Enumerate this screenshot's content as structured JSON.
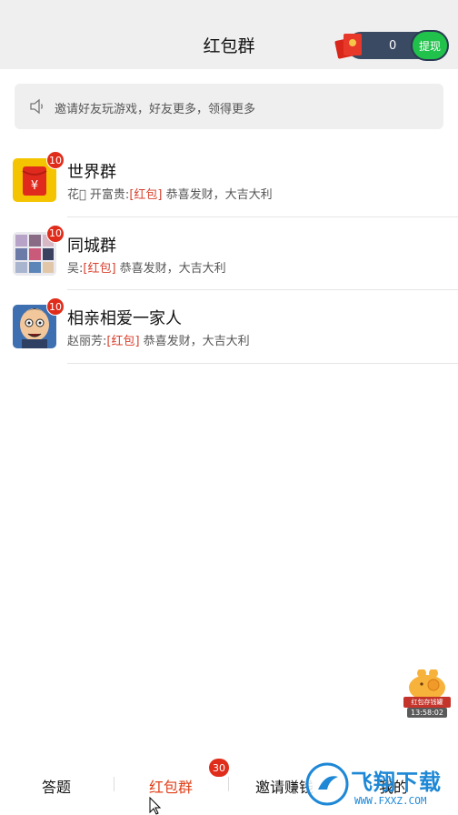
{
  "header": {
    "title": "红包群",
    "wallet_amount": "0",
    "withdraw_label": "提现"
  },
  "notice": {
    "text": "邀请好友玩游戏，好友更多，领得更多"
  },
  "groups": [
    {
      "name": "世界群",
      "badge": "10",
      "sender": "花\u0000 开富贵:",
      "tag": "[红包]",
      "message": " 恭喜发财，大吉大利"
    },
    {
      "name": "同城群",
      "badge": "10",
      "sender": "吴:",
      "tag": "[红包]",
      "message": " 恭喜发财，大吉大利"
    },
    {
      "name": "相亲相爱一家人",
      "badge": "10",
      "sender": "赵丽芳:",
      "tag": "[红包]",
      "message": " 恭喜发财，大吉大利"
    }
  ],
  "float_widget": {
    "label": "红包存钱罐",
    "time": "13:58:02"
  },
  "bottom_nav": {
    "items": [
      "答题",
      "红包群",
      "邀请赚钱",
      "我的"
    ],
    "badge": "30"
  },
  "watermark": {
    "text": "飞翔下载",
    "url": "WWW.FXXZ.COM"
  },
  "colors": {
    "accent": "#e0401a",
    "badge": "#e02d1b",
    "withdraw": "#21c24b"
  }
}
